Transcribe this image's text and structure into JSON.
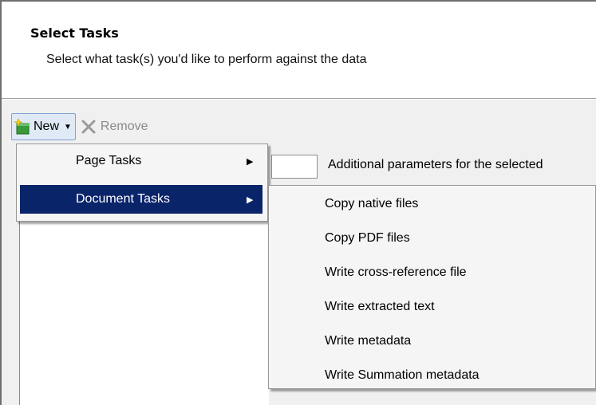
{
  "header": {
    "title": "Select Tasks",
    "subtitle": "Select what task(s) you'd like to perform against the data"
  },
  "toolbar": {
    "new_label": "New",
    "remove_label": "Remove"
  },
  "params_label": "Additional parameters for the selected",
  "menu": {
    "items": [
      {
        "label": "Page Tasks"
      },
      {
        "label": "Document Tasks"
      }
    ]
  },
  "submenu": {
    "items": [
      {
        "label": "Copy native files"
      },
      {
        "label": "Copy PDF files"
      },
      {
        "label": "Write cross-reference file"
      },
      {
        "label": "Write extracted text"
      },
      {
        "label": "Write metadata"
      },
      {
        "label": "Write Summation metadata"
      }
    ]
  },
  "colors": {
    "selection": "#0a246a",
    "new_button_bg": "#dfeaf6",
    "disabled_text": "#8a8a8a"
  },
  "icons": {
    "new": "new-task-icon",
    "remove": "remove-x-icon",
    "caret": "dropdown-caret-icon",
    "submenu_arrow": "submenu-arrow-icon"
  }
}
